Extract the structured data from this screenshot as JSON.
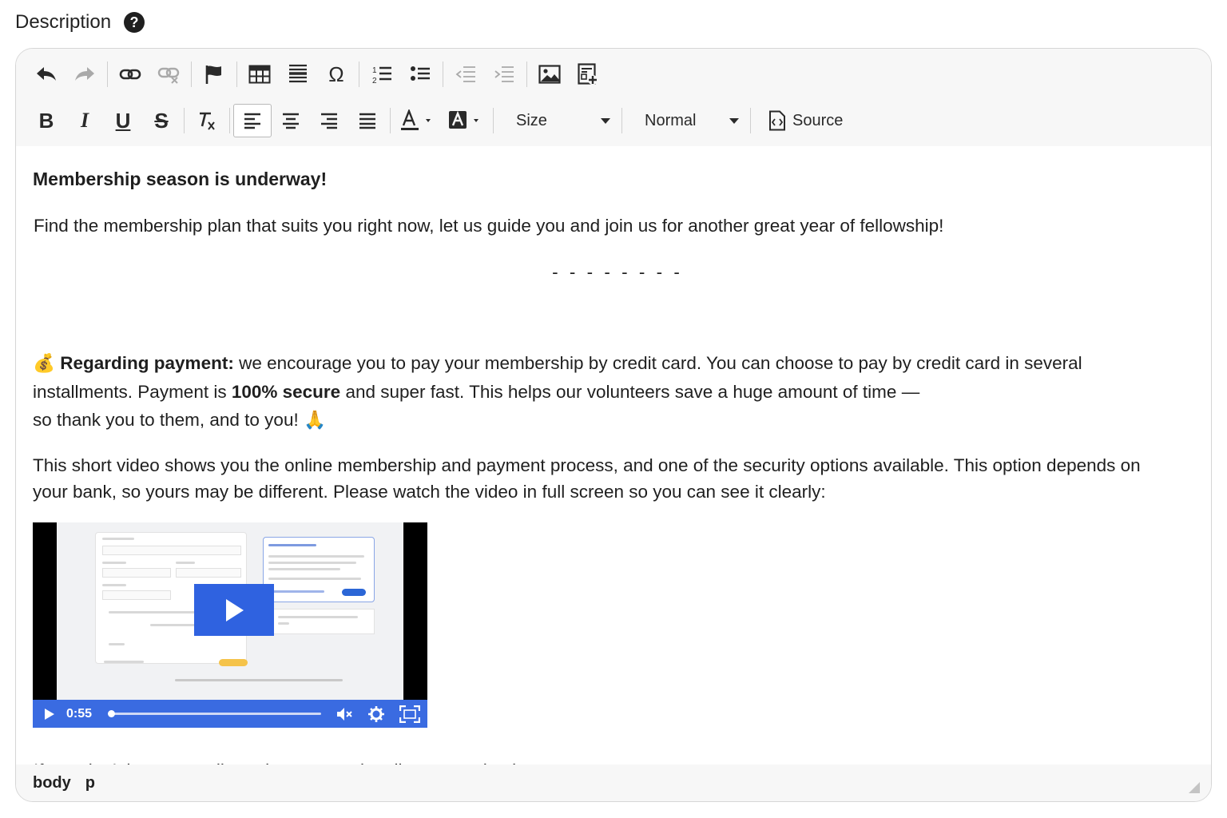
{
  "field": {
    "label": "Description",
    "help_glyph": "?"
  },
  "toolbar": {
    "row1": [
      "undo-icon",
      "redo-icon",
      "link-icon",
      "unlink-icon",
      "anchor-flag-icon",
      "table-icon",
      "horizontal-line-icon",
      "special-char-omega-icon",
      "numbered-list-icon",
      "bulleted-list-icon",
      "outdent-icon",
      "indent-icon",
      "image-icon",
      "insert-template-icon"
    ],
    "special_char_glyph": "Ω",
    "bold_glyph": "B",
    "italic_glyph": "I",
    "underline_glyph": "U",
    "strike_glyph": "S",
    "size_label": "Size",
    "format_value": "Normal",
    "source_label": "Source",
    "active_alignment": "align-left"
  },
  "content": {
    "heading": "Membership season is underway!",
    "intro": "Find the membership plan that suits you right now, let us guide you and join us for another great year of fellowship!",
    "divider": "- - - - - - - -",
    "payment": {
      "emoji": "💰",
      "label": "Regarding payment:",
      "text1": " we encourage you to pay your membership by credit card. You can choose to pay by credit card in several",
      "text2a": "installments. Payment is ",
      "secure": "100% secure",
      "text2b": " and super fast. This helps our volunteers save a huge amount of time —",
      "text3": "so thank you to them, and to you! ",
      "emoji2": "🙏"
    },
    "video_intro": "This short video shows you the online membership and payment process, and one of the security options available. This option depends on your bank, so yours may be different. Please watch the video in full screen so you can see it clearly:",
    "video": {
      "time": "0:55",
      "progress_fraction": 0.0,
      "accent_color": "#3a6be1"
    },
    "checks": "If you don’t have a credit card, we exceptionally accept checks."
  },
  "statusbar": {
    "path": [
      "body",
      "p"
    ]
  }
}
